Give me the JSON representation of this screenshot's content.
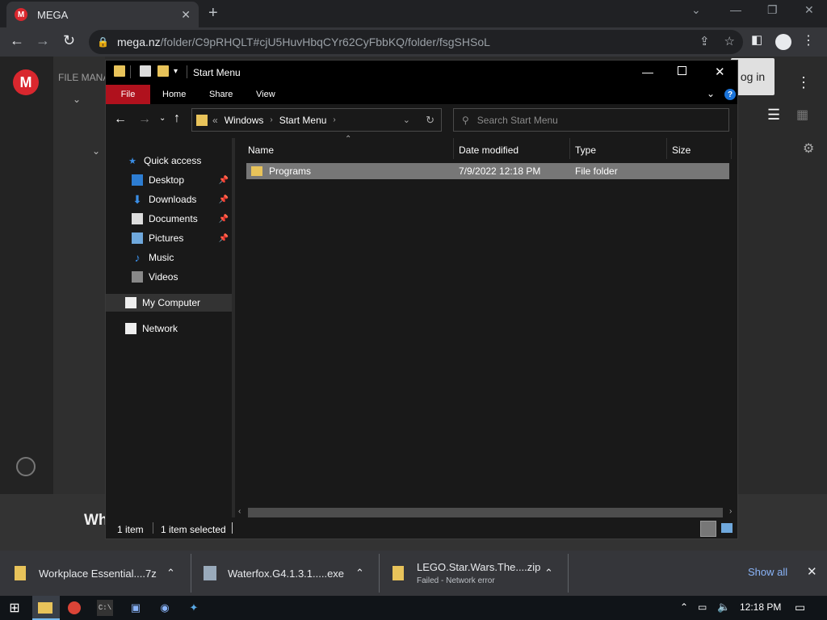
{
  "browser": {
    "tab_title": "MEGA",
    "tab_favicon": "M",
    "url_host": "mega.nz",
    "url_path": "/folder/C9pRHQLT#cjU5HuvHbqCYr62CyFbbKQ/folder/fsgSHSoL"
  },
  "mega": {
    "logo": "M",
    "file_manager_label": "FILE MANA",
    "login_label": "og in",
    "bottom_partial_text": "Wh"
  },
  "explorer": {
    "window_title": "Start Menu",
    "ribbon": {
      "file": "File",
      "home": "Home",
      "share": "Share",
      "view": "View"
    },
    "address": {
      "overflow": "«",
      "crumbs": [
        "Windows",
        "Start Menu"
      ]
    },
    "search_placeholder": "Search Start Menu",
    "nav": {
      "quick_access": "Quick access",
      "items": [
        {
          "label": "Desktop",
          "icon": "desktop-icon",
          "pinned": true
        },
        {
          "label": "Downloads",
          "icon": "downloads-icon",
          "pinned": true
        },
        {
          "label": "Documents",
          "icon": "documents-icon",
          "pinned": true
        },
        {
          "label": "Pictures",
          "icon": "pictures-icon",
          "pinned": true
        },
        {
          "label": "Music",
          "icon": "music-icon",
          "pinned": false
        },
        {
          "label": "Videos",
          "icon": "videos-icon",
          "pinned": false
        }
      ],
      "my_computer": "My Computer",
      "network": "Network"
    },
    "columns": {
      "name": "Name",
      "date_modified": "Date modified",
      "type": "Type",
      "size": "Size"
    },
    "rows": [
      {
        "name": "Programs",
        "date_modified": "7/9/2022 12:18 PM",
        "type": "File folder",
        "size": ""
      }
    ],
    "status": {
      "count": "1 item",
      "selected": "1 item selected"
    }
  },
  "downloads": [
    {
      "name": "Workplace Essential....7z",
      "status": ""
    },
    {
      "name": "Waterfox.G4.1.3.1.....exe",
      "status": ""
    },
    {
      "name": "LEGO.Star.Wars.The....zip",
      "status": "Failed - Network error"
    }
  ],
  "downloads_show_all": "Show all",
  "taskbar": {
    "clock": "12:18 PM"
  },
  "colors": {
    "accent_file_tab": "#b0111d",
    "mega_red": "#d9272e",
    "selection": "#777777",
    "link_blue": "#8ab4f8"
  }
}
